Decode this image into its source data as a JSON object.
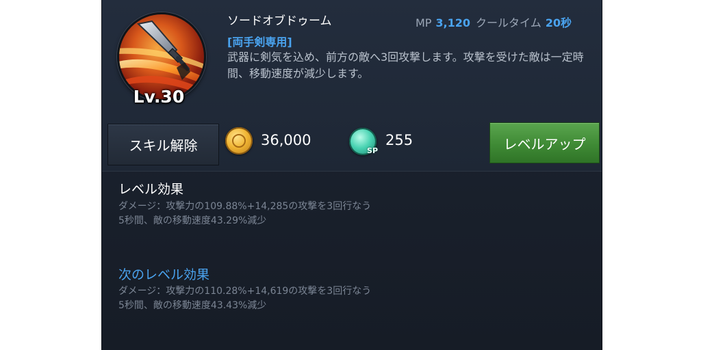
{
  "skill": {
    "name": "ソードオブドゥーム",
    "level": "Lv.30",
    "weapon_requirement": "[両手剣専用]",
    "description": "武器に剣気を込め、前方の敵へ3回攻撃します。攻撃を受けた敵は一定時間、移動速度が減少します。",
    "mp_label": "MP",
    "mp_value": "3,120",
    "cooldown_label": "クールタイム",
    "cooldown_value": "20秒",
    "icon": "sword-slash-skill-icon"
  },
  "actions": {
    "reset_label": "スキル解除",
    "levelup_label": "レベルアップ",
    "gold_cost": "36,000",
    "sp_cost": "255",
    "sp_badge": "SP"
  },
  "level_effect": {
    "title": "レベル効果",
    "lines": [
      "ダメージ：攻撃力の109.88%+14,285の攻撃を3回行なう",
      "5秒間、敵の移動速度43.29%減少"
    ]
  },
  "next_level_effect": {
    "title": "次のレベル効果",
    "lines": [
      "ダメージ：攻撃力の110.28%+14,619の攻撃を3回行なう",
      "5秒間、敵の移動速度43.43%減少"
    ]
  },
  "colors": {
    "accent_blue": "#4aa3ef",
    "levelup_green": "#3f8a35",
    "panel_bg": "#1d2533"
  }
}
